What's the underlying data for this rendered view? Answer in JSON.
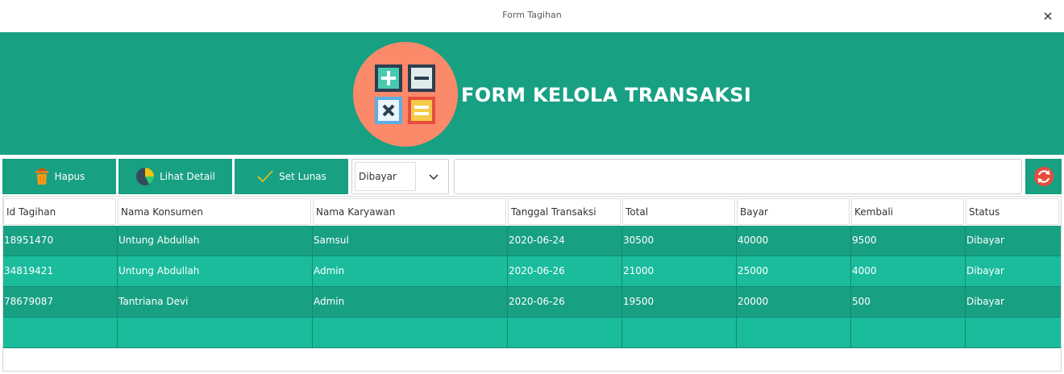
{
  "window": {
    "title": "Form Tagihan",
    "close_icon": "close-icon"
  },
  "header": {
    "title": "FORM KELOLA TRANSAKSI",
    "logo_icon": "calculator-icon",
    "background": "#18a083"
  },
  "toolbar": {
    "hapus_label": "Hapus",
    "detail_label": "Lihat Detail",
    "lunas_label": "Set Lunas",
    "filter_selected": "Dibayar",
    "search_value": ""
  },
  "table": {
    "columns": [
      "Id Tagihan",
      "Nama Konsumen",
      "Nama Karyawan",
      "Tanggal Transaksi",
      "Total",
      "Bayar",
      "Kembali",
      "Status"
    ],
    "rows": [
      [
        "18951470",
        "Untung Abdullah",
        "Samsul",
        "2020-06-24",
        "30500",
        "40000",
        "9500",
        "Dibayar"
      ],
      [
        "34819421",
        "Untung Abdullah",
        "Admin",
        "2020-06-26",
        "21000",
        "25000",
        "4000",
        "Dibayar"
      ],
      [
        "78679087",
        "Tantriana Devi",
        "Admin",
        "2020-06-26",
        "19500",
        "20000",
        "500",
        "Dibayar"
      ],
      [
        "",
        "",
        "",
        "",
        "",
        "",
        "",
        ""
      ]
    ]
  },
  "colors": {
    "row_dark": "#18a083",
    "row_light": "#1abc9c",
    "accent": "#e74c3c"
  }
}
